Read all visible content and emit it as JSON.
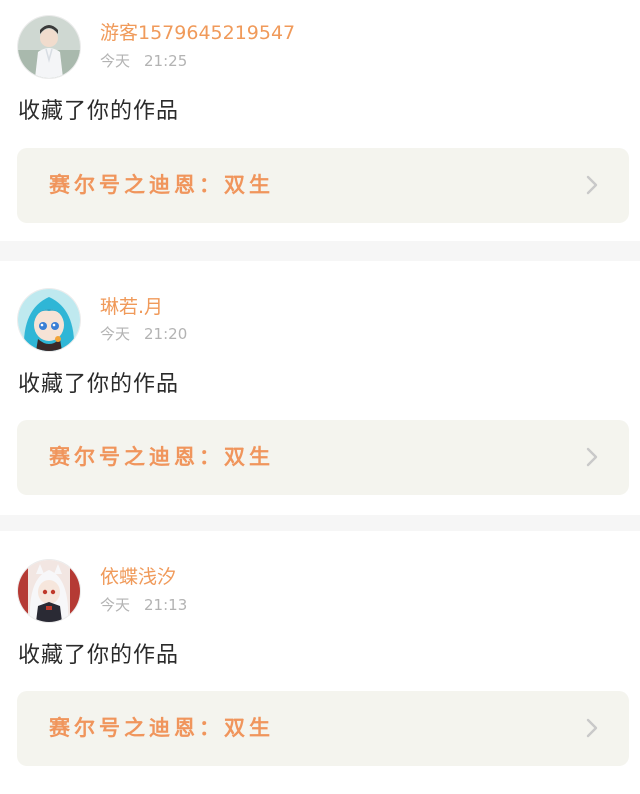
{
  "colors": {
    "username": "#f09a5a",
    "work_title": "#f0955c",
    "meta_text": "#b3b3b3",
    "card_bg": "#ffffff",
    "work_bg": "#f4f4ee",
    "divider": "#f6f6f6"
  },
  "notifications": [
    {
      "username": "游客1579645219547",
      "day": "今天",
      "time": "21:25",
      "action": "收藏了你的作品",
      "work_title": "赛尔号之迪恩：双生",
      "avatar_icon": "avatar-white-hanfu-boy",
      "chevron_icon": "chevron-right-icon"
    },
    {
      "username": "琳若.月",
      "day": "今天",
      "time": "21:20",
      "action": "收藏了你的作品",
      "work_title": "赛尔号之迪恩：双生",
      "avatar_icon": "avatar-anime-blue-hair-girl",
      "chevron_icon": "chevron-right-icon"
    },
    {
      "username": "依蝶浅汐",
      "day": "今天",
      "time": "21:13",
      "action": "收藏了你的作品",
      "work_title": "赛尔号之迪恩：双生",
      "avatar_icon": "avatar-anime-white-hair-girl",
      "chevron_icon": "chevron-right-icon"
    }
  ]
}
